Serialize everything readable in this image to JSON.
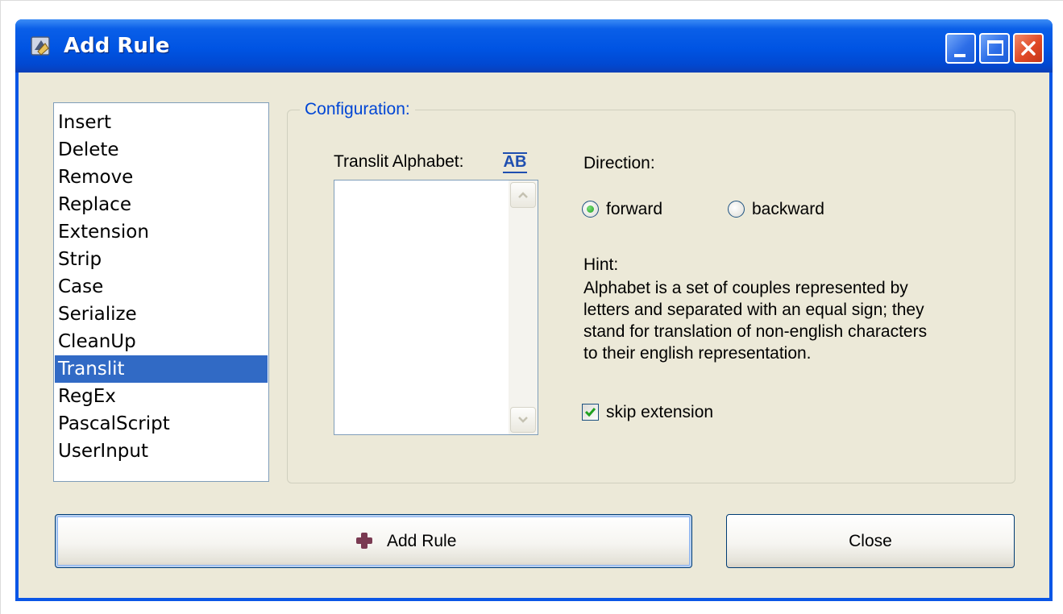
{
  "window": {
    "title": "Add Rule",
    "title_icon": "app-icon",
    "controls": [
      "minimize-icon",
      "maximize-icon",
      "close-icon"
    ]
  },
  "rule_list": {
    "items": [
      "Insert",
      "Delete",
      "Remove",
      "Replace",
      "Extension",
      "Strip",
      "Case",
      "Serialize",
      "CleanUp",
      "Translit",
      "RegEx",
      "PascalScript",
      "UserInput"
    ],
    "selected": "Translit"
  },
  "configuration": {
    "legend": "Configuration:",
    "alphabet_label": "Translit Alphabet:",
    "alphabet_icon_text": "AB",
    "alphabet_value": "",
    "direction_label": "Direction:",
    "direction_options": [
      "forward",
      "backward"
    ],
    "direction_selected": "forward",
    "hint_label": "Hint:",
    "hint_lines": [
      "Alphabet is a set of couples represented by",
      "letters and separated with an equal sign; they",
      "stand for translation of non-english characters",
      "to their english representation."
    ],
    "skip_extension_label": "skip extension",
    "skip_extension_checked": true
  },
  "buttons": {
    "add_rule_label": "Add Rule",
    "close_label": "Close"
  },
  "colors": {
    "titlebar": "#0054e3",
    "dialog_bg": "#ece9d8",
    "selection": "#316ac5",
    "legend_text": "#0046d5",
    "close_button": "#e04a26"
  }
}
